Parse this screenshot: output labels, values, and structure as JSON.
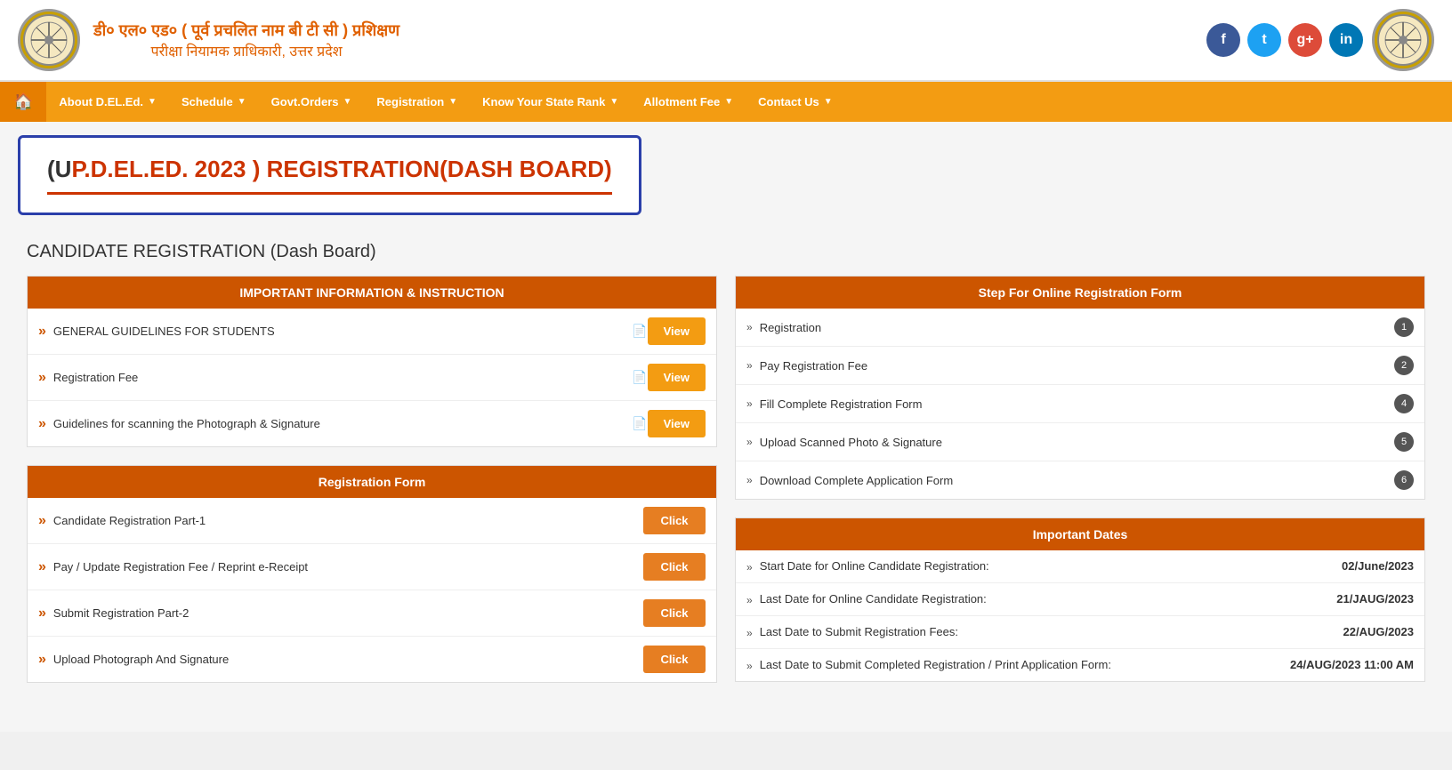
{
  "header": {
    "title_line1": "डी० एल० एड० ( पूर्व प्रचलित नाम बी टी सी ) प्रशिक्षण",
    "title_line2": "परीक्षा नियामक प्राधिकारी, उत्तर प्रदेश",
    "logo_alt": "UP Logo"
  },
  "social": {
    "facebook": "f",
    "twitter": "t",
    "googleplus": "g+",
    "linkedin": "in"
  },
  "navbar": {
    "home": "🏠",
    "items": [
      {
        "label": "About D.EL.Ed.",
        "has_dropdown": true
      },
      {
        "label": "Schedule",
        "has_dropdown": true
      },
      {
        "label": "Govt.Orders",
        "has_dropdown": true
      },
      {
        "label": "Registration",
        "has_dropdown": true
      },
      {
        "label": "Know Your State Rank",
        "has_dropdown": true
      },
      {
        "label": "Allotment Fee",
        "has_dropdown": true
      },
      {
        "label": "Contact Us",
        "has_dropdown": true
      }
    ]
  },
  "page_title": {
    "prefix": "(U",
    "colored": "P.D.EL.ED. 2023 ) REGISTRATION(DASH BOARD)",
    "full": "(UP.D.EL.ED. 2023 ) REGISTRATION(DASH BOARD)"
  },
  "dashboard_title": "CANDIDATE REGISTRATION (Dash Board)",
  "important_info": {
    "header": "IMPORTANT INFORMATION & INSTRUCTION",
    "rows": [
      {
        "text": "GENERAL GUIDELINES FOR STUDENTS",
        "has_icon": true,
        "btn": "View"
      },
      {
        "text": "Registration Fee",
        "has_icon": true,
        "btn": "View"
      },
      {
        "text": "Guidelines for scanning the Photograph & Signature",
        "has_icon": true,
        "btn": "View"
      }
    ]
  },
  "registration_form": {
    "header": "Registration Form",
    "rows": [
      {
        "text": "Candidate Registration Part-1",
        "btn": "Click"
      },
      {
        "text": "Pay / Update Registration Fee / Reprint e-Receipt",
        "btn": "Click"
      },
      {
        "text": "Submit Registration Part-2",
        "btn": "Click"
      },
      {
        "text": "Upload Photograph And Signature",
        "btn": "Click"
      }
    ]
  },
  "steps": {
    "header": "Step For Online Registration Form",
    "rows": [
      {
        "text": "Registration",
        "badge": "1"
      },
      {
        "text": "Pay Registration Fee",
        "badge": "2"
      },
      {
        "text": "Fill Complete Registration Form",
        "badge": "4"
      },
      {
        "text": "Upload Scanned Photo & Signature",
        "badge": "5"
      },
      {
        "text": "Download Complete Application Form",
        "badge": "6"
      }
    ]
  },
  "important_dates": {
    "header": "Important Dates",
    "rows": [
      {
        "label": "Start Date for Online Candidate Registration:",
        "value": "02/June/2023"
      },
      {
        "label": "Last Date for Online Candidate Registration:",
        "value": "21/JAUG/2023"
      },
      {
        "label": "Last Date to Submit Registration Fees:",
        "value": "22/AUG/2023"
      },
      {
        "label": "Last Date to Submit Completed Registration / Print Application Form:",
        "value": "24/AUG/2023 11:00 AM"
      }
    ]
  }
}
